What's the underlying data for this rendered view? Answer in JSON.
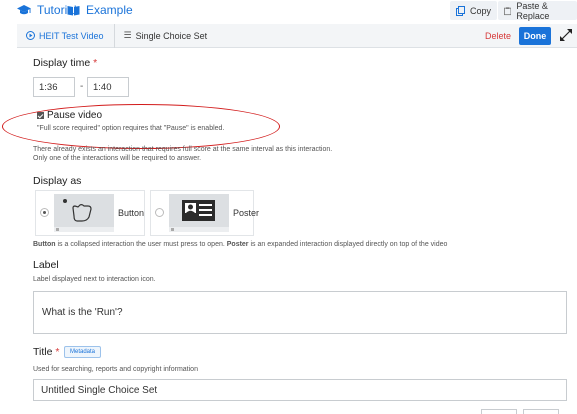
{
  "topbar": {
    "tutorial_label": "Tutorial",
    "example_label": "Example",
    "copy_label": "Copy",
    "paste_label": "Paste & Replace"
  },
  "editor": {
    "video_crumb": "HEIT Test Video",
    "interaction_crumb": "Single Choice Set",
    "delete_label": "Delete",
    "done_label": "Done"
  },
  "display_time": {
    "label": "Display time",
    "required_mark": "*",
    "from": "1:36",
    "separator": "-",
    "to": "1:40"
  },
  "pause_video": {
    "checked": true,
    "label": "Pause video",
    "note": "\"Full score required\" option requires that \"Pause\" is enabled."
  },
  "warning": {
    "line1": "There already exists an interaction that requires full score at the same interval as this interaction.",
    "line2": "Only one of the interactions will be required to answer."
  },
  "display_as": {
    "label": "Display as",
    "options": [
      {
        "label": "Button",
        "selected": true
      },
      {
        "label": "Poster",
        "selected": false
      }
    ],
    "desc_button_term": "Button",
    "desc_button_text": " is a collapsed interaction the user must press to open. ",
    "desc_poster_term": "Poster",
    "desc_poster_text": " is an expanded interaction displayed directly on top of the video"
  },
  "label_field": {
    "label": "Label",
    "description": "Label displayed next to interaction icon.",
    "value": "What is the 'Run'?"
  },
  "title_field": {
    "label": "Title",
    "required_mark": "*",
    "metadata_label": "Metadata",
    "description": "Used for searching, reports and copyright information",
    "value": "Untitled Single Choice Set"
  },
  "colors": {
    "accent": "#1a73d9",
    "danger": "#d63939",
    "annotation": "#d21a1a"
  }
}
